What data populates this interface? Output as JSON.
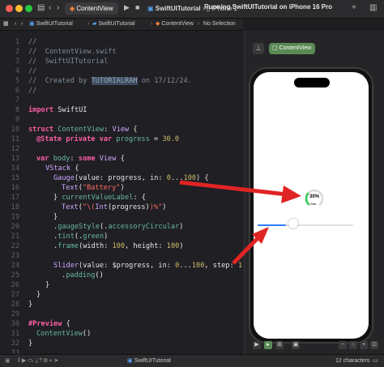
{
  "window": {
    "tab_project": "SwiftUITutorial",
    "tab_device": "iPhone 1",
    "run_status": "Running SwiftUITutorial on iPhone 16 Pro",
    "active_file_tab": "ContentView"
  },
  "breadcrumb": {
    "project": "SwiftUITutorial",
    "group": "SwiftUITutorial",
    "file": "ContentView",
    "selection": "No Selection"
  },
  "editor": {
    "line_numbers": [
      "1",
      "2",
      "3",
      "4",
      "5",
      "6",
      "7",
      "8",
      "9",
      "10",
      "11",
      "12",
      "13",
      "14",
      "15",
      "16",
      "17",
      "18",
      "19",
      "20",
      "21",
      "22",
      "23",
      "24",
      "25",
      "26",
      "27",
      "28",
      "29",
      "30",
      "31",
      "32",
      "33"
    ],
    "header_comment_file": "//  ContentView.swift",
    "header_comment_project": "//  SwiftUITutorial",
    "created_by_prefix": "//  Created by ",
    "created_by_name": "TUTORIALRAH",
    "created_on": " on 17/12/24.",
    "comment_blank": "//",
    "kw_import": "import",
    "mod_swiftui": "SwiftUI",
    "kw_struct": "struct",
    "name_contentview": "ContentView",
    "type_view": "View",
    "attr_state": "@State",
    "kw_private": "private",
    "kw_var": "var",
    "var_progress": "progress",
    "num_progress": "30.0",
    "var_body": "body",
    "kw_some": "some",
    "type_vstack": "VStack",
    "type_gauge": "Gauge",
    "arg_value": "value:",
    "arg_in": "in:",
    "num_range_0": "0",
    "range_op": "...",
    "num_range_100": "100",
    "type_text": "Text",
    "str_battery": "\"Battery\"",
    "fn_current_value_label": "currentValueLabel",
    "str_interp_open": "\"\\(",
    "type_int": "Int",
    "str_interp_close": ")%\"",
    "fn_gauge_style": "gaugeStyle",
    "style_circular": "accessoryCircular",
    "fn_tint": "tint",
    "color_green": "green",
    "fn_frame": "frame",
    "arg_width": "width:",
    "arg_height": "height:",
    "num_100": "100",
    "type_slider": "Slider",
    "binding_progress": "$progress",
    "arg_step": "step:",
    "num_1": "1",
    "fn_padding": "padding",
    "macro_preview": "#Preview",
    "tokens": {
      "brace_open": "{",
      "brace_close": "}",
      "paren_open": "(",
      "paren_close": ")",
      "paren_empty": "()",
      "colon": ":",
      "comma": ",",
      "equals": "=",
      "dot": "."
    }
  },
  "canvas": {
    "pin_icon": "pin-icon",
    "preview_chip_label": "ContentView",
    "gauge": {
      "value_text": "30%",
      "label_text": "Batt...",
      "progress": 0.3,
      "tint": "#34c759"
    },
    "slider": {
      "progress": 0.3,
      "accent": "#2d7ff9"
    }
  },
  "statusbar": {
    "scheme": "SwiftUITutorial",
    "char_count": "12 characters"
  },
  "colors": {
    "arrow_red": "#e02424",
    "xcode_green_chip": "#5a8a55"
  }
}
